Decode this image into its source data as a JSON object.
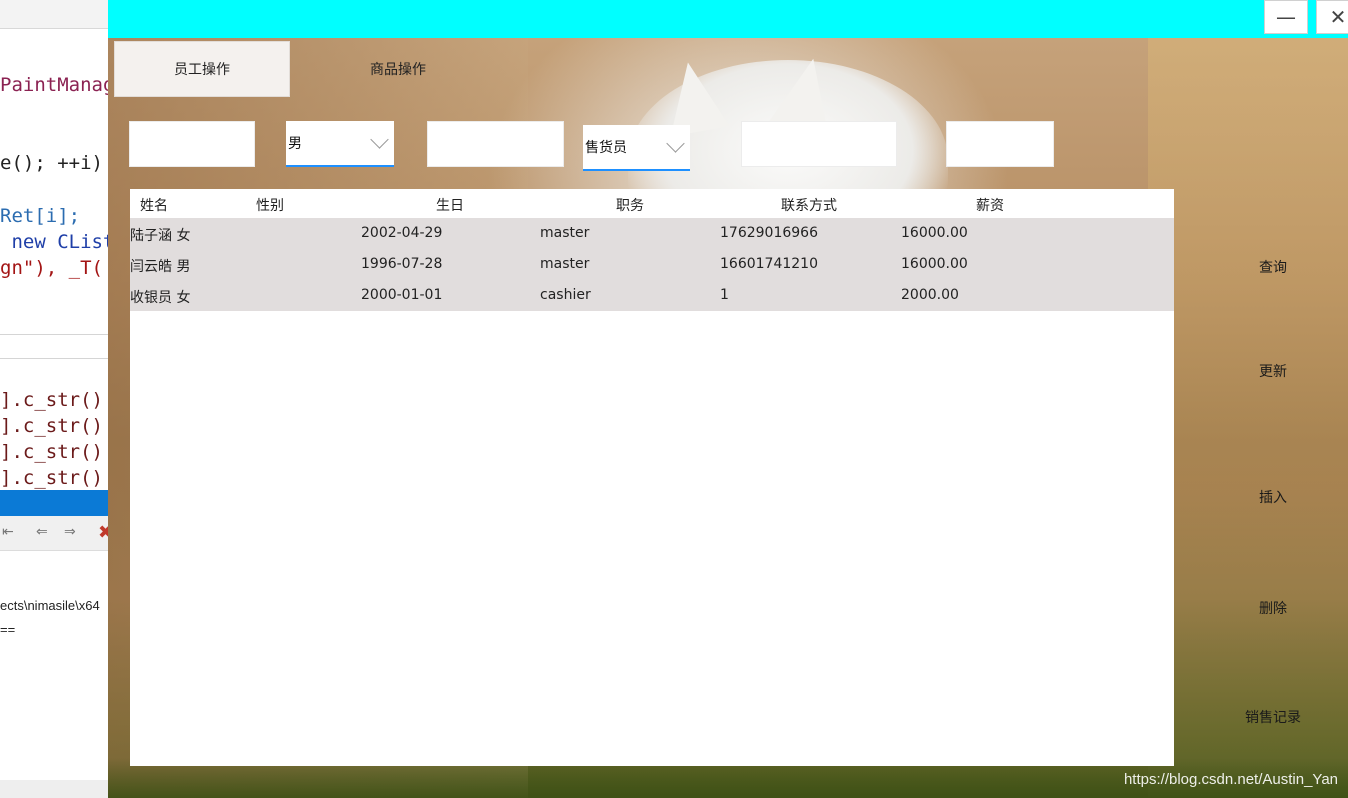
{
  "ide": {
    "code_lines": [
      "PaintManag",
      "e(); ++i)",
      "Ret[i];",
      " new CList",
      "gn\"), _T(",
      "].c_str()",
      "].c_str()",
      "].c_str()",
      "].c_str()"
    ],
    "output_lines": [
      "ects\\nimasile\\x64",
      "=="
    ]
  },
  "window": {
    "minimize_glyph": "—",
    "close_glyph": "✕"
  },
  "tabs": [
    {
      "label": "员工操作",
      "active": true
    },
    {
      "label": "商品操作",
      "active": false
    }
  ],
  "filters": {
    "name_value": "",
    "gender_value": "男",
    "birthday_value": "",
    "position_value": "售货员",
    "contact_value": "",
    "salary_value": ""
  },
  "table": {
    "headers": [
      "姓名",
      "性别",
      "生日",
      "职务",
      "联系方式",
      "薪资"
    ],
    "rows": [
      {
        "name_gender": "陆子涵 女",
        "birthday": "2002-04-29",
        "position": "master",
        "contact": "17629016966",
        "salary": "16000.00"
      },
      {
        "name_gender": "闫云皓 男",
        "birthday": "1996-07-28",
        "position": "master",
        "contact": "16601741210",
        "salary": "16000.00"
      },
      {
        "name_gender": "收银员 女",
        "birthday": "2000-01-01",
        "position": "cashier",
        "contact": "1",
        "salary": "2000.00"
      }
    ]
  },
  "actions": {
    "query": "查询",
    "update": "更新",
    "insert": "插入",
    "delete": "删除",
    "sales_record": "销售记录"
  },
  "watermark": "https://blog.csdn.net/Austin_Yan"
}
